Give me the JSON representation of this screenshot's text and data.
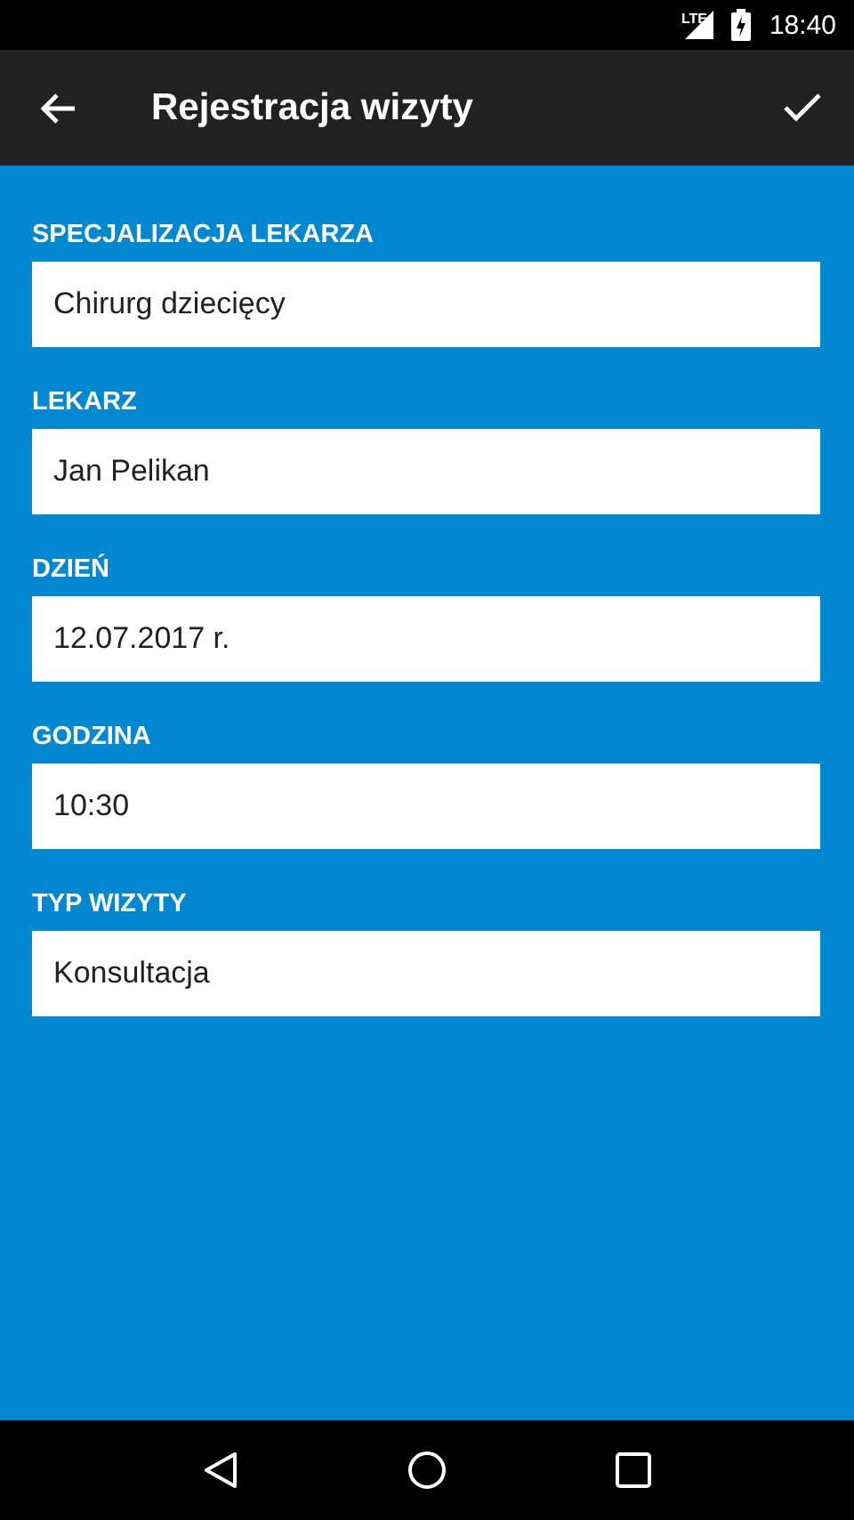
{
  "status_bar": {
    "network": "LTE",
    "time": "18:40"
  },
  "app_bar": {
    "title": "Rejestracja wizyty"
  },
  "fields": [
    {
      "label": "SPECJALIZACJA LEKARZA",
      "value": "Chirurg dziecięcy"
    },
    {
      "label": "LEKARZ",
      "value": "Jan Pelikan"
    },
    {
      "label": "DZIEŃ",
      "value": "12.07.2017 r."
    },
    {
      "label": "GODZINA",
      "value": "10:30"
    },
    {
      "label": "TYP WIZYTY",
      "value": "Konsultacja"
    }
  ]
}
